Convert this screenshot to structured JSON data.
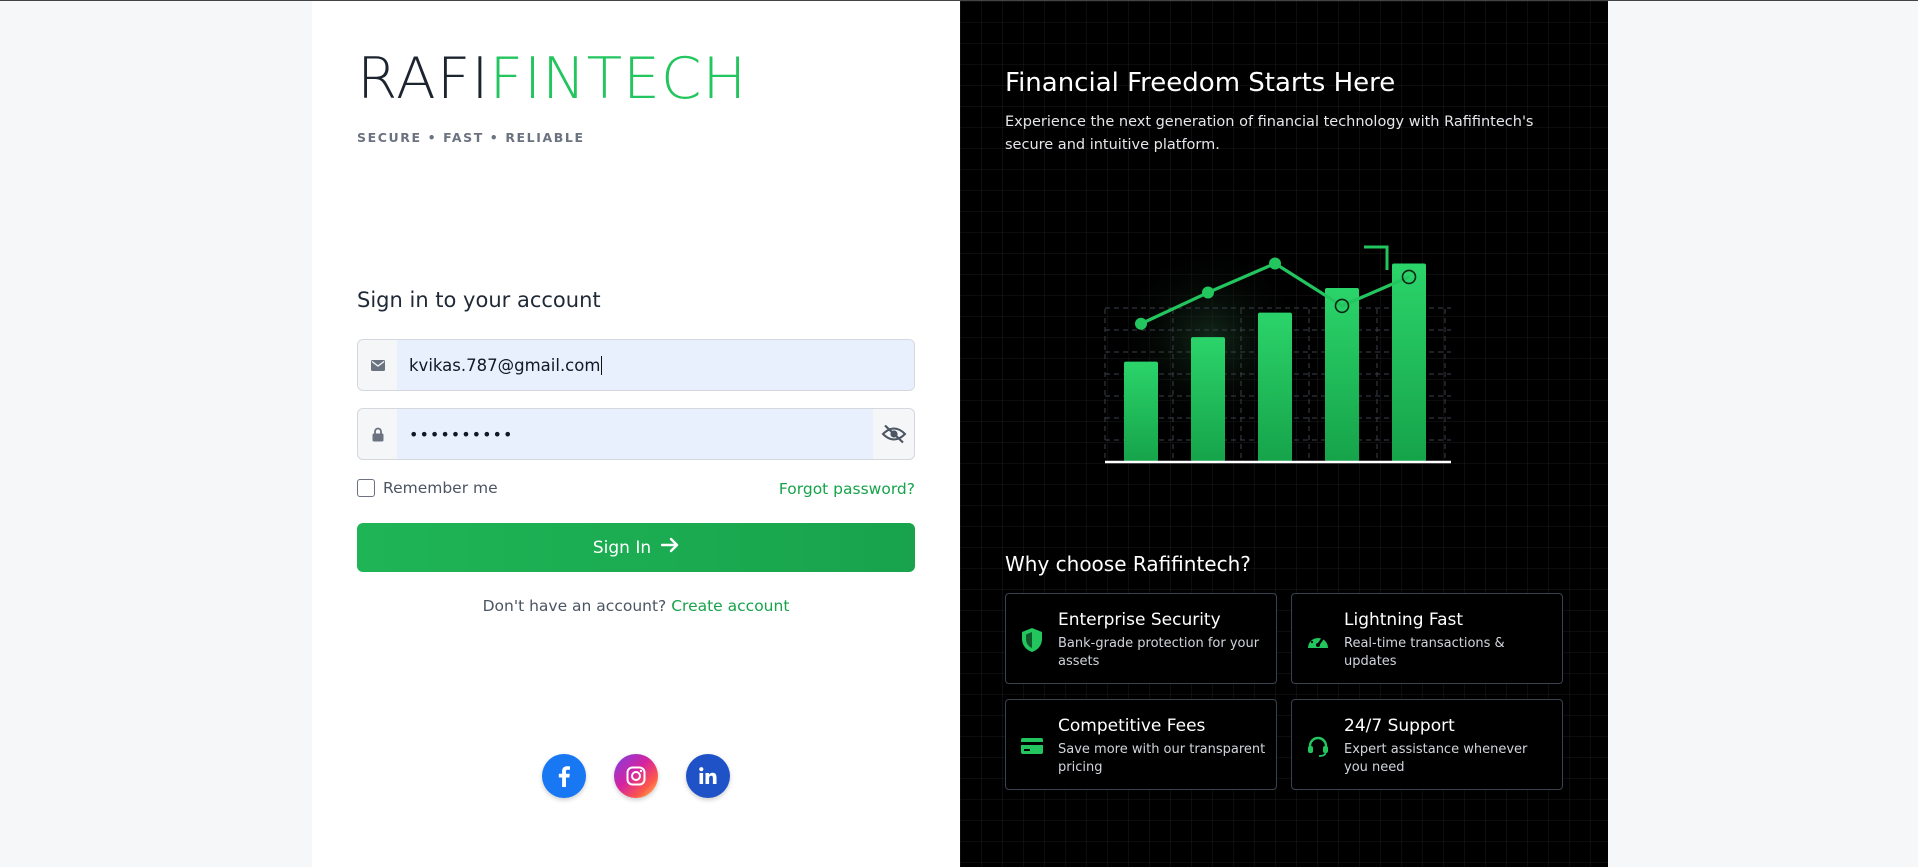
{
  "brand": {
    "part1": "RAFI",
    "part2": "FINTECH",
    "tagline": "SECURE • FAST • RELIABLE",
    "accent_color": "#22c55e"
  },
  "login": {
    "title": "Sign in to your account",
    "email_value": "kvikas.787@gmail.com",
    "email_icon": "mail-icon",
    "password_value": "••••••••••",
    "password_icon": "lock-icon",
    "toggle_icon": "eye-off-icon",
    "remember_label": "Remember me",
    "forgot_label": "Forgot password?",
    "signin_label": "Sign In",
    "no_account_text": "Don't have an account?",
    "create_account_label": "Create account"
  },
  "social": [
    {
      "name": "facebook-icon",
      "color": "#1877f2"
    },
    {
      "name": "instagram-icon",
      "color": "#d6249f"
    },
    {
      "name": "linkedin-icon",
      "color": "#1f51c7"
    }
  ],
  "hero": {
    "title": "Financial Freedom Starts Here",
    "subtitle": "Experience the next generation of financial technology with Rafifintech's secure and intuitive platform."
  },
  "chart_data": {
    "type": "bar",
    "bar_values": [
      45,
      56,
      67,
      78,
      89
    ],
    "line_values": [
      62,
      76,
      89,
      70,
      83
    ],
    "open_markers": [
      3,
      4
    ],
    "color": "#22c55e",
    "grid": true
  },
  "why": {
    "title": "Why choose Rafifintech?",
    "cards": [
      {
        "title": "Enterprise Security",
        "desc": "Bank-grade protection for your assets",
        "icon": "shield-icon"
      },
      {
        "title": "Lightning Fast",
        "desc": "Real-time transactions & updates",
        "icon": "speedometer-icon"
      },
      {
        "title": "Competitive Fees",
        "desc": "Save more with our transparent pricing",
        "icon": "credit-card-icon"
      },
      {
        "title": "24/7 Support",
        "desc": "Expert assistance whenever you need",
        "icon": "headset-icon"
      }
    ]
  }
}
